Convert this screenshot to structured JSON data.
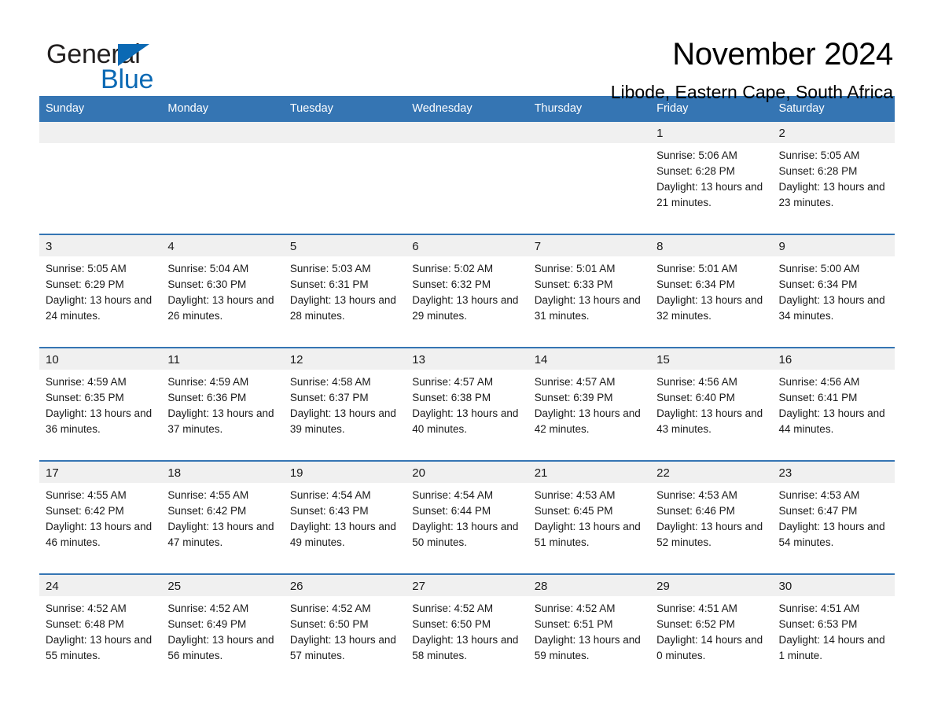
{
  "brand": {
    "name_part1": "General",
    "name_part2": "Blue",
    "triangle_color": "#0b69b4"
  },
  "header": {
    "title": "November 2024",
    "location": "Libode, Eastern Cape, South Africa"
  },
  "theme": {
    "header_blue": "#3575b3",
    "daynum_gray": "#f0f0f0",
    "text_color": "#1a1a1a"
  },
  "weekday_headers": [
    "Sunday",
    "Monday",
    "Tuesday",
    "Wednesday",
    "Thursday",
    "Friday",
    "Saturday"
  ],
  "weeks": [
    [
      {
        "day": "",
        "sunrise": "",
        "sunset": "",
        "daylight": ""
      },
      {
        "day": "",
        "sunrise": "",
        "sunset": "",
        "daylight": ""
      },
      {
        "day": "",
        "sunrise": "",
        "sunset": "",
        "daylight": ""
      },
      {
        "day": "",
        "sunrise": "",
        "sunset": "",
        "daylight": ""
      },
      {
        "day": "",
        "sunrise": "",
        "sunset": "",
        "daylight": ""
      },
      {
        "day": "1",
        "sunrise": "Sunrise: 5:06 AM",
        "sunset": "Sunset: 6:28 PM",
        "daylight": "Daylight: 13 hours and 21 minutes."
      },
      {
        "day": "2",
        "sunrise": "Sunrise: 5:05 AM",
        "sunset": "Sunset: 6:28 PM",
        "daylight": "Daylight: 13 hours and 23 minutes."
      }
    ],
    [
      {
        "day": "3",
        "sunrise": "Sunrise: 5:05 AM",
        "sunset": "Sunset: 6:29 PM",
        "daylight": "Daylight: 13 hours and 24 minutes."
      },
      {
        "day": "4",
        "sunrise": "Sunrise: 5:04 AM",
        "sunset": "Sunset: 6:30 PM",
        "daylight": "Daylight: 13 hours and 26 minutes."
      },
      {
        "day": "5",
        "sunrise": "Sunrise: 5:03 AM",
        "sunset": "Sunset: 6:31 PM",
        "daylight": "Daylight: 13 hours and 28 minutes."
      },
      {
        "day": "6",
        "sunrise": "Sunrise: 5:02 AM",
        "sunset": "Sunset: 6:32 PM",
        "daylight": "Daylight: 13 hours and 29 minutes."
      },
      {
        "day": "7",
        "sunrise": "Sunrise: 5:01 AM",
        "sunset": "Sunset: 6:33 PM",
        "daylight": "Daylight: 13 hours and 31 minutes."
      },
      {
        "day": "8",
        "sunrise": "Sunrise: 5:01 AM",
        "sunset": "Sunset: 6:34 PM",
        "daylight": "Daylight: 13 hours and 32 minutes."
      },
      {
        "day": "9",
        "sunrise": "Sunrise: 5:00 AM",
        "sunset": "Sunset: 6:34 PM",
        "daylight": "Daylight: 13 hours and 34 minutes."
      }
    ],
    [
      {
        "day": "10",
        "sunrise": "Sunrise: 4:59 AM",
        "sunset": "Sunset: 6:35 PM",
        "daylight": "Daylight: 13 hours and 36 minutes."
      },
      {
        "day": "11",
        "sunrise": "Sunrise: 4:59 AM",
        "sunset": "Sunset: 6:36 PM",
        "daylight": "Daylight: 13 hours and 37 minutes."
      },
      {
        "day": "12",
        "sunrise": "Sunrise: 4:58 AM",
        "sunset": "Sunset: 6:37 PM",
        "daylight": "Daylight: 13 hours and 39 minutes."
      },
      {
        "day": "13",
        "sunrise": "Sunrise: 4:57 AM",
        "sunset": "Sunset: 6:38 PM",
        "daylight": "Daylight: 13 hours and 40 minutes."
      },
      {
        "day": "14",
        "sunrise": "Sunrise: 4:57 AM",
        "sunset": "Sunset: 6:39 PM",
        "daylight": "Daylight: 13 hours and 42 minutes."
      },
      {
        "day": "15",
        "sunrise": "Sunrise: 4:56 AM",
        "sunset": "Sunset: 6:40 PM",
        "daylight": "Daylight: 13 hours and 43 minutes."
      },
      {
        "day": "16",
        "sunrise": "Sunrise: 4:56 AM",
        "sunset": "Sunset: 6:41 PM",
        "daylight": "Daylight: 13 hours and 44 minutes."
      }
    ],
    [
      {
        "day": "17",
        "sunrise": "Sunrise: 4:55 AM",
        "sunset": "Sunset: 6:42 PM",
        "daylight": "Daylight: 13 hours and 46 minutes."
      },
      {
        "day": "18",
        "sunrise": "Sunrise: 4:55 AM",
        "sunset": "Sunset: 6:42 PM",
        "daylight": "Daylight: 13 hours and 47 minutes."
      },
      {
        "day": "19",
        "sunrise": "Sunrise: 4:54 AM",
        "sunset": "Sunset: 6:43 PM",
        "daylight": "Daylight: 13 hours and 49 minutes."
      },
      {
        "day": "20",
        "sunrise": "Sunrise: 4:54 AM",
        "sunset": "Sunset: 6:44 PM",
        "daylight": "Daylight: 13 hours and 50 minutes."
      },
      {
        "day": "21",
        "sunrise": "Sunrise: 4:53 AM",
        "sunset": "Sunset: 6:45 PM",
        "daylight": "Daylight: 13 hours and 51 minutes."
      },
      {
        "day": "22",
        "sunrise": "Sunrise: 4:53 AM",
        "sunset": "Sunset: 6:46 PM",
        "daylight": "Daylight: 13 hours and 52 minutes."
      },
      {
        "day": "23",
        "sunrise": "Sunrise: 4:53 AM",
        "sunset": "Sunset: 6:47 PM",
        "daylight": "Daylight: 13 hours and 54 minutes."
      }
    ],
    [
      {
        "day": "24",
        "sunrise": "Sunrise: 4:52 AM",
        "sunset": "Sunset: 6:48 PM",
        "daylight": "Daylight: 13 hours and 55 minutes."
      },
      {
        "day": "25",
        "sunrise": "Sunrise: 4:52 AM",
        "sunset": "Sunset: 6:49 PM",
        "daylight": "Daylight: 13 hours and 56 minutes."
      },
      {
        "day": "26",
        "sunrise": "Sunrise: 4:52 AM",
        "sunset": "Sunset: 6:50 PM",
        "daylight": "Daylight: 13 hours and 57 minutes."
      },
      {
        "day": "27",
        "sunrise": "Sunrise: 4:52 AM",
        "sunset": "Sunset: 6:50 PM",
        "daylight": "Daylight: 13 hours and 58 minutes."
      },
      {
        "day": "28",
        "sunrise": "Sunrise: 4:52 AM",
        "sunset": "Sunset: 6:51 PM",
        "daylight": "Daylight: 13 hours and 59 minutes."
      },
      {
        "day": "29",
        "sunrise": "Sunrise: 4:51 AM",
        "sunset": "Sunset: 6:52 PM",
        "daylight": "Daylight: 14 hours and 0 minutes."
      },
      {
        "day": "30",
        "sunrise": "Sunrise: 4:51 AM",
        "sunset": "Sunset: 6:53 PM",
        "daylight": "Daylight: 14 hours and 1 minute."
      }
    ]
  ]
}
